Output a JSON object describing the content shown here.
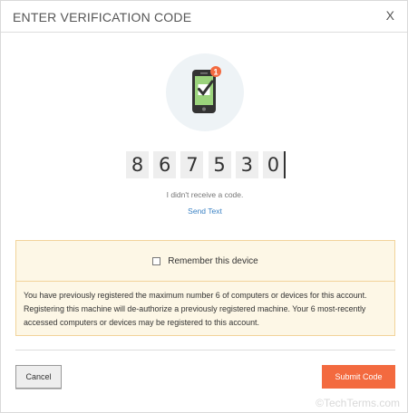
{
  "dialog": {
    "title": "ENTER VERIFICATION CODE",
    "close_label": "X"
  },
  "icon": {
    "name": "phone-verified-icon",
    "badge_count": "1",
    "colors": {
      "circle": "#eef3f6",
      "phone": "#333333",
      "screen": "#9bd37c",
      "check": "#333333",
      "badge": "#f36a3f"
    }
  },
  "code": {
    "digits": [
      "8",
      "6",
      "7",
      "5",
      "3",
      "0"
    ]
  },
  "resend": {
    "prompt": "I didn't receive a code.",
    "link": "Send Text"
  },
  "notice": {
    "remember_label": "Remember this device",
    "remember_checked": false,
    "message": "You have previously registered the maximum number 6 of computers or devices for this account. Registering this machine will de-authorize a previously registered machine. Your 6 most-recently accessed computers or devices may be registered to this account."
  },
  "actions": {
    "cancel_label": "Cancel",
    "submit_label": "Submit Code"
  },
  "colors": {
    "accent": "#f36a3f",
    "link": "#3b82c4",
    "notice_bg": "#fdf7e6",
    "notice_border": "#f2d39a"
  },
  "watermark": "©TechTerms.com"
}
